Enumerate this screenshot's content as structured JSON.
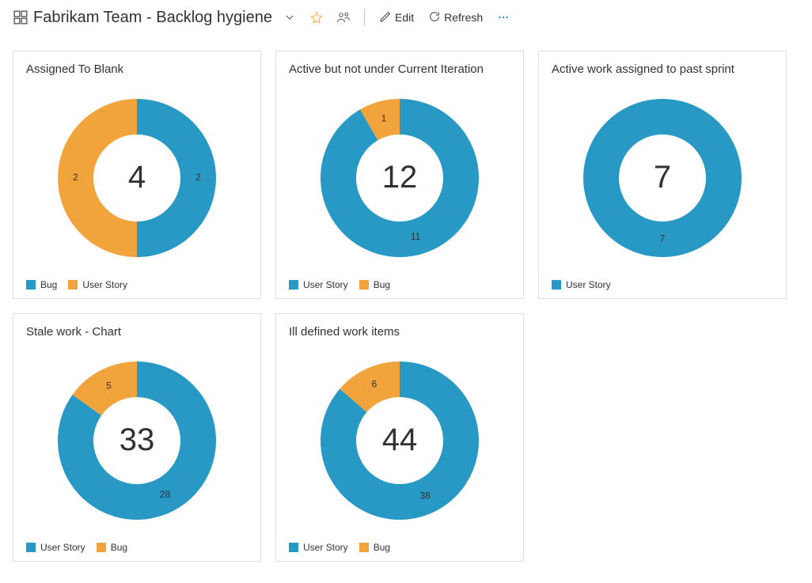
{
  "header": {
    "title": "Fabrikam Team - Backlog hygiene",
    "edit_label": "Edit",
    "refresh_label": "Refresh"
  },
  "colors": {
    "blue": "#2899c5",
    "orange": "#f2a43c"
  },
  "cards": [
    {
      "title": "Assigned To Blank",
      "total": 4,
      "series": [
        {
          "name": "Bug",
          "value": 2,
          "color": "blue"
        },
        {
          "name": "User Story",
          "value": 2,
          "color": "orange"
        }
      ]
    },
    {
      "title": "Active but not under Current Iteration",
      "total": 12,
      "series": [
        {
          "name": "User Story",
          "value": 11,
          "color": "blue"
        },
        {
          "name": "Bug",
          "value": 1,
          "color": "orange"
        }
      ]
    },
    {
      "title": "Active work assigned to past sprint",
      "total": 7,
      "series": [
        {
          "name": "User Story",
          "value": 7,
          "color": "blue"
        }
      ]
    },
    {
      "title": "Stale work - Chart",
      "total": 33,
      "series": [
        {
          "name": "User Story",
          "value": 28,
          "color": "blue"
        },
        {
          "name": "Bug",
          "value": 5,
          "color": "orange"
        }
      ]
    },
    {
      "title": "Ill defined work items",
      "total": 44,
      "series": [
        {
          "name": "User Story",
          "value": 38,
          "color": "blue"
        },
        {
          "name": "Bug",
          "value": 6,
          "color": "orange"
        }
      ]
    }
  ],
  "chart_data": [
    {
      "type": "pie",
      "title": "Assigned To Blank",
      "total": 4,
      "series": [
        {
          "name": "Bug",
          "value": 2
        },
        {
          "name": "User Story",
          "value": 2
        }
      ]
    },
    {
      "type": "pie",
      "title": "Active but not under Current Iteration",
      "total": 12,
      "series": [
        {
          "name": "User Story",
          "value": 11
        },
        {
          "name": "Bug",
          "value": 1
        }
      ]
    },
    {
      "type": "pie",
      "title": "Active work assigned to past sprint",
      "total": 7,
      "series": [
        {
          "name": "User Story",
          "value": 7
        }
      ]
    },
    {
      "type": "pie",
      "title": "Stale work - Chart",
      "total": 33,
      "series": [
        {
          "name": "User Story",
          "value": 28
        },
        {
          "name": "Bug",
          "value": 5
        }
      ]
    },
    {
      "type": "pie",
      "title": "Ill defined work items",
      "total": 44,
      "series": [
        {
          "name": "User Story",
          "value": 38
        },
        {
          "name": "Bug",
          "value": 6
        }
      ]
    }
  ]
}
